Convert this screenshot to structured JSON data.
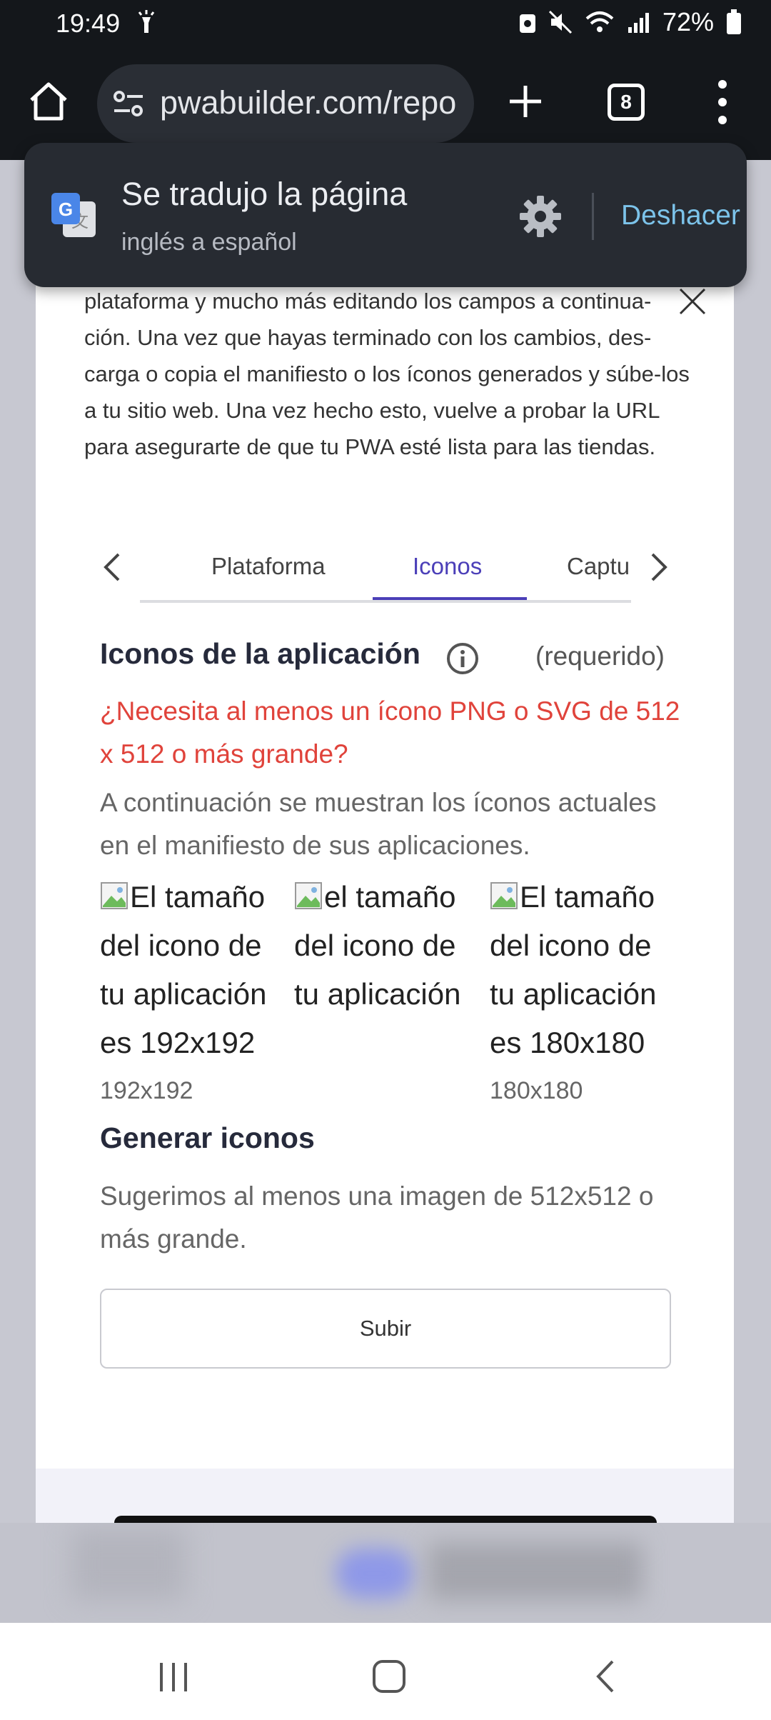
{
  "status": {
    "time": "19:49",
    "battery": "72%"
  },
  "browser": {
    "url": "pwabuilder.com/repo",
    "tab_count": "8"
  },
  "translate": {
    "title": "Se tradujo la página",
    "subtitle": "inglés a español",
    "undo_label": "Deshacer"
  },
  "intro_text": "plataforma y mucho más editando los campos a continua-ción. Una vez que hayas terminado con los cambios, des-carga o copia el manifiesto o los íconos generados y súbe-los a tu sitio web. Una vez hecho esto, vuelve a probar la URL para asegurarte de que tu PWA esté lista para las tiendas.",
  "tabs": [
    {
      "label": "Plataforma",
      "active": false
    },
    {
      "label": "Iconos",
      "active": true
    },
    {
      "label": "Captu",
      "active": false
    }
  ],
  "app_icons": {
    "title": "Iconos de la aplicación",
    "required_label": "(requerido)",
    "warning": "¿Necesita al menos un ícono PNG o SVG de 512 x 512 o más grande?",
    "description": "A continuación se muestran los íconos actuales en el manifiesto de sus aplicaciones.",
    "icons": [
      {
        "alt": "El tamaño del icono de tu aplicación es 192x192",
        "size": "192x192"
      },
      {
        "alt": "el tamaño del icono de tu aplicación",
        "size": ""
      },
      {
        "alt": "El tamaño del icono de tu aplicación es 180x180",
        "size": "180x180"
      }
    ]
  },
  "generate": {
    "title": "Generar iconos",
    "description": "Sugerimos al menos una imagen de 512x512 o más grande.",
    "upload_label": "Subir"
  },
  "colors": {
    "accent": "#4b3fb8",
    "warning": "#e0433b",
    "link": "#7cc3ea"
  }
}
